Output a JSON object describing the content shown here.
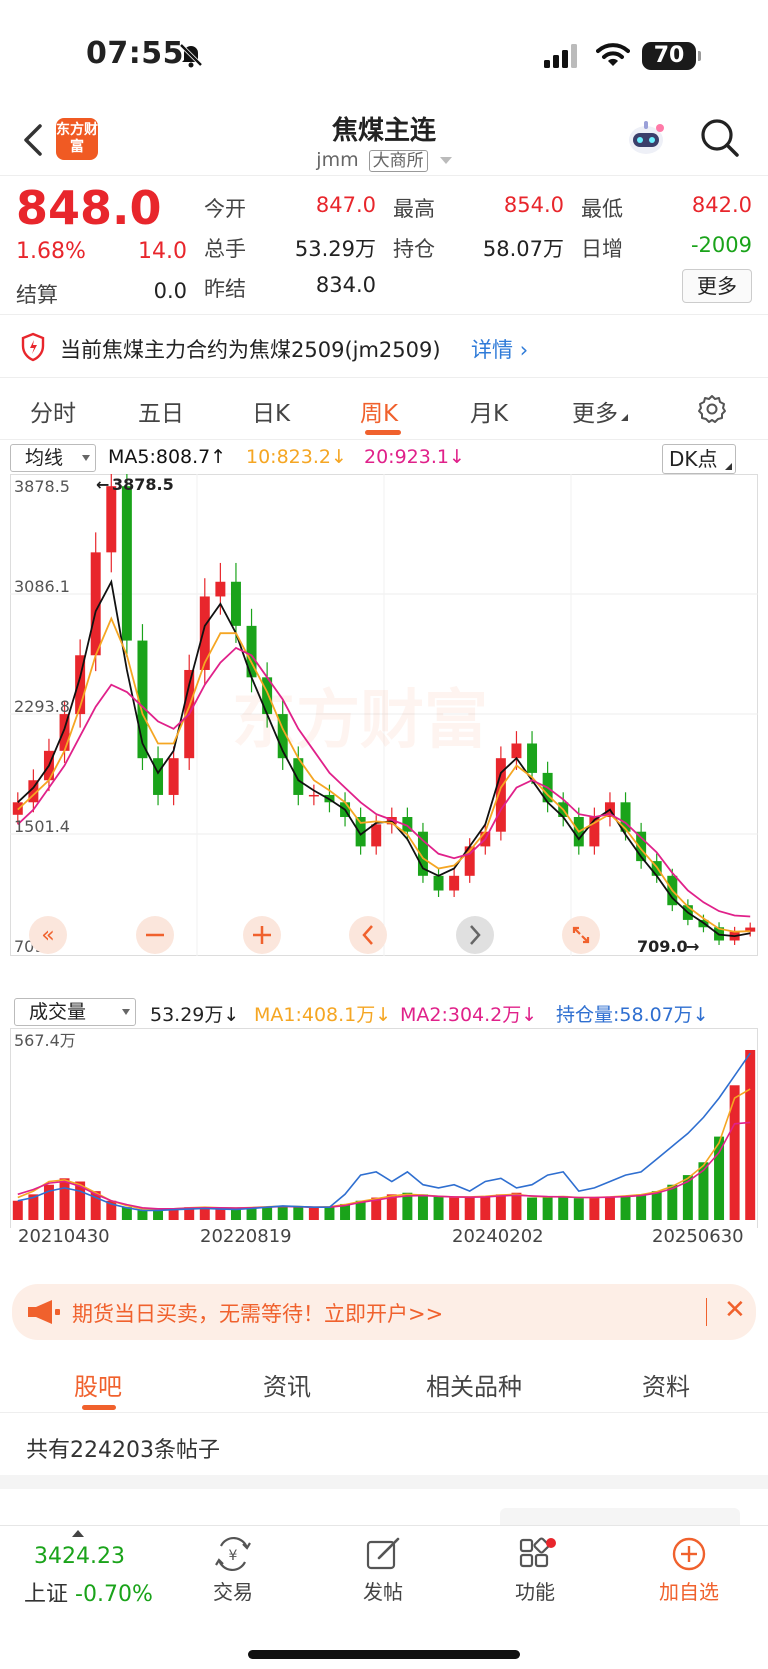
{
  "status": {
    "time": "07:55",
    "battery": "70"
  },
  "nav": {
    "title": "焦煤主连",
    "code": "jmm",
    "exchange": "大商所",
    "logo": "东方财富"
  },
  "quote": {
    "price": "848.0",
    "change_pct": "1.68%",
    "change": "14.0",
    "open_label": "今开",
    "open": "847.0",
    "high_label": "最高",
    "high": "854.0",
    "low_label": "最低",
    "low": "842.0",
    "volume_label": "总手",
    "volume": "53.29万",
    "oi_label": "持仓",
    "oi": "58.07万",
    "daily_inc_label": "日增",
    "daily_inc": "-2009",
    "settle_label": "结算",
    "settle": "0.0",
    "prev_settle_label": "昨结",
    "prev_settle": "834.0",
    "more_label": "更多"
  },
  "notice": {
    "text": "当前焦煤主力合约为焦煤2509(jm2509)",
    "link": "详情"
  },
  "tabs": [
    "分时",
    "五日",
    "日K",
    "周K",
    "月K",
    "更多"
  ],
  "active_tab": "周K",
  "ma_bar": {
    "selector": "均线",
    "ma5": "MA5:808.7",
    "ma10": "10:823.2",
    "ma20": "20:923.1",
    "dk": "DK点"
  },
  "vol_bar": {
    "selector": "成交量",
    "vol": "53.29万",
    "ma1": "MA1:408.1万",
    "ma2": "MA2:304.2万",
    "oi": "持仓量:58.07万"
  },
  "chart_data": [
    {
      "type": "candlestick",
      "title": "焦煤主连 周K",
      "y_ticks": [
        "3878.5",
        "3086.1",
        "2293.8",
        "1501.4",
        "709.0"
      ],
      "ylim": [
        709.0,
        3878.5
      ],
      "high_marker": "3878.5",
      "low_marker": "709.0",
      "watermark": "东方财富",
      "series": [
        {
          "name": "close",
          "values": [
            1700,
            1850,
            2050,
            2300,
            2700,
            3400,
            3850,
            2800,
            2000,
            1750,
            2000,
            2600,
            3100,
            3200,
            2900,
            2550,
            2300,
            2000,
            1750,
            1750,
            1700,
            1600,
            1400,
            1550,
            1600,
            1500,
            1200,
            1100,
            1200,
            1400,
            1500,
            2000,
            2100,
            1900,
            1700,
            1600,
            1400,
            1600,
            1700,
            1500,
            1300,
            1200,
            1000,
            900,
            850,
            760,
            820,
            848
          ]
        },
        {
          "name": "MA5",
          "color": "#111111",
          "values": [
            1700,
            1800,
            1950,
            2200,
            2550,
            3000,
            3200,
            2600,
            2100,
            1900,
            2050,
            2500,
            2900,
            3050,
            2850,
            2550,
            2300,
            2050,
            1850,
            1780,
            1720,
            1650,
            1480,
            1560,
            1570,
            1450,
            1250,
            1200,
            1250,
            1400,
            1550,
            1900,
            2000,
            1850,
            1700,
            1600,
            1450,
            1580,
            1650,
            1480,
            1330,
            1200,
            1050,
            950,
            880,
            800,
            790,
            808.7
          ]
        },
        {
          "name": "MA10",
          "color": "#f5a623",
          "values": [
            1650,
            1750,
            1850,
            2050,
            2350,
            2700,
            2950,
            2700,
            2300,
            2100,
            2100,
            2350,
            2650,
            2850,
            2850,
            2650,
            2450,
            2200,
            2000,
            1850,
            1780,
            1700,
            1560,
            1570,
            1560,
            1480,
            1320,
            1250,
            1270,
            1370,
            1500,
            1800,
            1950,
            1870,
            1750,
            1650,
            1500,
            1560,
            1620,
            1520,
            1380,
            1260,
            1100,
            990,
            910,
            840,
            820,
            823.2
          ]
        },
        {
          "name": "MA20",
          "color": "#e0218a",
          "values": [
            1550,
            1650,
            1800,
            1950,
            2150,
            2350,
            2500,
            2450,
            2350,
            2250,
            2200,
            2300,
            2500,
            2650,
            2750,
            2700,
            2550,
            2400,
            2200,
            2050,
            1900,
            1800,
            1700,
            1620,
            1580,
            1540,
            1440,
            1350,
            1320,
            1350,
            1450,
            1650,
            1800,
            1850,
            1800,
            1720,
            1620,
            1600,
            1620,
            1560,
            1460,
            1360,
            1220,
            1100,
            1020,
            960,
            930,
            923.1
          ]
        }
      ]
    },
    {
      "type": "bar",
      "title": "成交量",
      "y_ticks": [
        "567.4万"
      ],
      "x_ticks": [
        "20210430",
        "20220819",
        "20240202",
        "20250630"
      ],
      "ylim": [
        0,
        567.4
      ],
      "series": [
        {
          "name": "volume",
          "values": [
            60,
            80,
            110,
            130,
            120,
            90,
            60,
            40,
            30,
            30,
            35,
            40,
            40,
            38,
            35,
            40,
            42,
            45,
            40,
            38,
            42,
            50,
            60,
            70,
            80,
            85,
            80,
            75,
            70,
            72,
            75,
            80,
            85,
            70,
            72,
            75,
            68,
            70,
            72,
            76,
            80,
            90,
            110,
            140,
            180,
            260,
            420,
            530
          ]
        },
        {
          "name": "MA1",
          "color": "#f5a623",
          "values": [
            70,
            90,
            120,
            125,
            110,
            85,
            60,
            45,
            35,
            33,
            35,
            38,
            40,
            38,
            37,
            39,
            41,
            43,
            42,
            40,
            41,
            48,
            58,
            66,
            75,
            80,
            78,
            74,
            72,
            72,
            74,
            78,
            80,
            74,
            72,
            73,
            70,
            70,
            72,
            75,
            79,
            88,
            105,
            130,
            170,
            240,
            380,
            408.1
          ]
        },
        {
          "name": "MA2",
          "color": "#e0218a",
          "values": [
            80,
            95,
            115,
            120,
            105,
            80,
            60,
            48,
            38,
            35,
            35,
            37,
            38,
            38,
            37,
            38,
            40,
            42,
            41,
            40,
            40,
            45,
            55,
            62,
            70,
            75,
            76,
            74,
            72,
            71,
            72,
            75,
            77,
            75,
            73,
            72,
            70,
            70,
            71,
            73,
            76,
            84,
            98,
            120,
            155,
            210,
            300,
            304.2
          ]
        },
        {
          "name": "持仓量",
          "color": "#2f6fd0",
          "values": [
            60,
            70,
            90,
            100,
            90,
            70,
            50,
            38,
            30,
            30,
            32,
            34,
            36,
            34,
            33,
            36,
            40,
            44,
            42,
            40,
            40,
            80,
            140,
            150,
            120,
            150,
            110,
            100,
            110,
            90,
            120,
            130,
            100,
            110,
            140,
            150,
            90,
            100,
            120,
            140,
            150,
            190,
            230,
            270,
            320,
            380,
            450,
            520
          ]
        }
      ]
    }
  ],
  "ad": {
    "text": "期货当日买卖，无需等待！立即开户>>"
  },
  "sub_tabs": [
    "股吧",
    "资讯",
    "相关品种",
    "资料"
  ],
  "active_sub_tab": "股吧",
  "post_count": "共有224203条帖子",
  "bottom": {
    "index_value": "3424.23",
    "index_name": "上证",
    "index_change": "-0.70%",
    "items": [
      "交易",
      "发帖",
      "功能",
      "加自选"
    ]
  }
}
